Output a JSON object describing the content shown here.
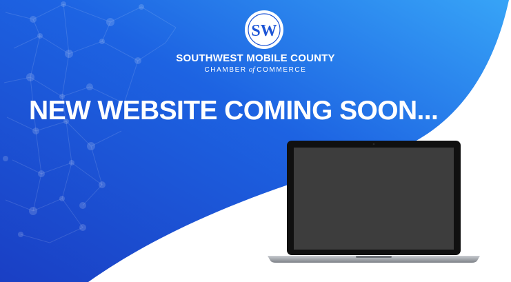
{
  "banner": {
    "logo_monogram": "SW",
    "org_name": "SOUTHWEST MOBILE COUNTY",
    "org_sub_before": "CHAMBER",
    "org_sub_connector": "of",
    "org_sub_after": "COMMERCE",
    "headline": "NEW WEBSITE COMING SOON..."
  },
  "colors": {
    "gradient_start": "#1a44c9",
    "gradient_end": "#2f9bf5",
    "text": "#ffffff",
    "laptop_screen": "#3d3d3d",
    "laptop_bezel": "#111111",
    "laptop_base": "#9ea2a8"
  },
  "icons": {
    "logo": "sw-seal-logo",
    "network": "network-pattern-decoration",
    "device": "laptop-mockup"
  }
}
